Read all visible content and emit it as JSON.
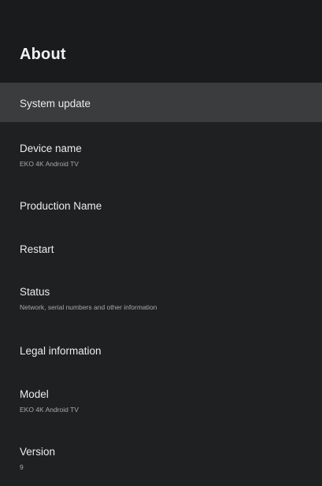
{
  "header": {
    "title": "About"
  },
  "items": [
    {
      "title": "System update",
      "subtitle": ""
    },
    {
      "title": "Device name",
      "subtitle": "EKO 4K Android TV"
    },
    {
      "title": "Production Name",
      "subtitle": ""
    },
    {
      "title": "Restart",
      "subtitle": ""
    },
    {
      "title": "Status",
      "subtitle": "Network, serial numbers and other information"
    },
    {
      "title": "Legal information",
      "subtitle": ""
    },
    {
      "title": "Model",
      "subtitle": "EKO 4K Android TV"
    },
    {
      "title": "Version",
      "subtitle": "9"
    }
  ],
  "focused_item": "System update",
  "colors": {
    "background": "#1f2022",
    "header_background": "#1a1b1d",
    "focused_background": "#3b3c3e",
    "title_text": "#ececec",
    "subtitle_text": "#a9a9a9"
  }
}
